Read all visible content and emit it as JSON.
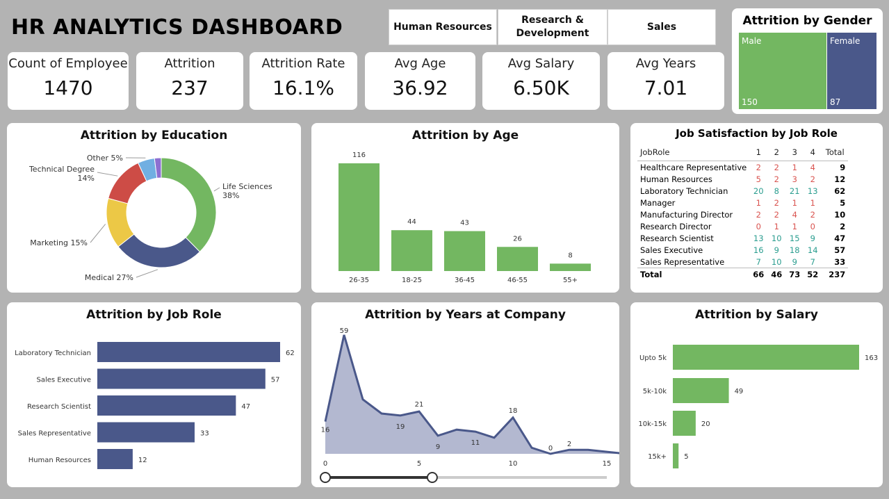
{
  "header": {
    "title": "HR ANALYTICS DASHBOARD"
  },
  "filters": [
    {
      "label": "Human Resources"
    },
    {
      "label": "Research & Development"
    },
    {
      "label": "Sales"
    }
  ],
  "kpis": [
    {
      "label": "Count of Employee",
      "value": "1470"
    },
    {
      "label": "Attrition",
      "value": "237"
    },
    {
      "label": "Attrition Rate",
      "value": "16.1%"
    },
    {
      "label": "Avg Age",
      "value": "36.92"
    },
    {
      "label": "Avg Salary",
      "value": "6.50K"
    },
    {
      "label": "Avg Years",
      "value": "7.01"
    }
  ],
  "gender": {
    "title": "Attrition by Gender",
    "items": [
      {
        "label": "Male",
        "value": "150",
        "color": "#73b761"
      },
      {
        "label": "Female",
        "value": "87",
        "color": "#4a588a"
      }
    ]
  },
  "education": {
    "title": "Attrition by Education",
    "slices": [
      {
        "label": "Life Sciences",
        "pct": "38%",
        "value": 38,
        "color": "#73b761"
      },
      {
        "label": "Medical",
        "pct": "27%",
        "value": 27,
        "color": "#4a588a"
      },
      {
        "label": "Marketing",
        "pct": "15%",
        "value": 15,
        "color": "#ecc846"
      },
      {
        "label": "Technical Degree",
        "pct": "14%",
        "value": 14,
        "color": "#cd4c46"
      },
      {
        "label": "Other",
        "pct": "5%",
        "value": 5,
        "color": "#71afe2"
      },
      {
        "label": "",
        "pct": "",
        "value": 2,
        "color": "#8d6fd1"
      }
    ]
  },
  "age": {
    "title": "Attrition by Age",
    "categories": [
      "26-35",
      "18-25",
      "36-45",
      "46-55",
      "55+"
    ],
    "values": [
      116,
      44,
      43,
      26,
      8
    ]
  },
  "jobsat": {
    "title": "Job Satisfaction by Job Role",
    "col_header": "JobRole",
    "levels": [
      "1",
      "2",
      "3",
      "4"
    ],
    "total_label": "Total",
    "rows": [
      {
        "role": "Healthcare Representative",
        "v": [
          2,
          2,
          1,
          4
        ],
        "total": 9
      },
      {
        "role": "Human Resources",
        "v": [
          5,
          2,
          3,
          2
        ],
        "total": 12
      },
      {
        "role": "Laboratory Technician",
        "v": [
          20,
          8,
          21,
          13
        ],
        "total": 62
      },
      {
        "role": "Manager",
        "v": [
          1,
          2,
          1,
          1
        ],
        "total": 5
      },
      {
        "role": "Manufacturing Director",
        "v": [
          2,
          2,
          4,
          2
        ],
        "total": 10
      },
      {
        "role": "Research Director",
        "v": [
          0,
          1,
          1,
          0
        ],
        "total": 2
      },
      {
        "role": "Research Scientist",
        "v": [
          13,
          10,
          15,
          9
        ],
        "total": 47
      },
      {
        "role": "Sales Executive",
        "v": [
          16,
          9,
          18,
          14
        ],
        "total": 57
      },
      {
        "role": "Sales Representative",
        "v": [
          7,
          10,
          9,
          7
        ],
        "total": 33
      }
    ],
    "totals": {
      "v": [
        66,
        46,
        73,
        52
      ],
      "total": 237
    }
  },
  "jobrole": {
    "title": "Attrition by Job Role",
    "categories": [
      "Laboratory Technician",
      "Sales Executive",
      "Research Scientist",
      "Sales Representative",
      "Human Resources"
    ],
    "values": [
      62,
      57,
      47,
      33,
      12
    ]
  },
  "years": {
    "title": "Attrition by Years at Company",
    "x": [
      0,
      1,
      2,
      3,
      4,
      5,
      6,
      7,
      8,
      9,
      10,
      11,
      12,
      13,
      14,
      15,
      16
    ],
    "y": [
      16,
      59,
      27,
      20,
      19,
      21,
      9,
      12,
      11,
      8,
      18,
      3,
      0,
      2,
      2,
      1,
      0
    ],
    "labels_shown": [
      0,
      1,
      4,
      5,
      6,
      8,
      10,
      12,
      13
    ],
    "xticks": [
      "0",
      "5",
      "10",
      "15"
    ],
    "slider": {
      "min": 0,
      "max": 5
    }
  },
  "salary": {
    "title": "Attrition by Salary",
    "categories": [
      "Upto 5k",
      "5k-10k",
      "10k-15k",
      "15k+"
    ],
    "values": [
      163,
      49,
      20,
      5
    ]
  },
  "colors": {
    "green": "#73b761",
    "navy": "#4a588a",
    "teal": "#2a9d8f",
    "red": "#d9534f"
  }
}
